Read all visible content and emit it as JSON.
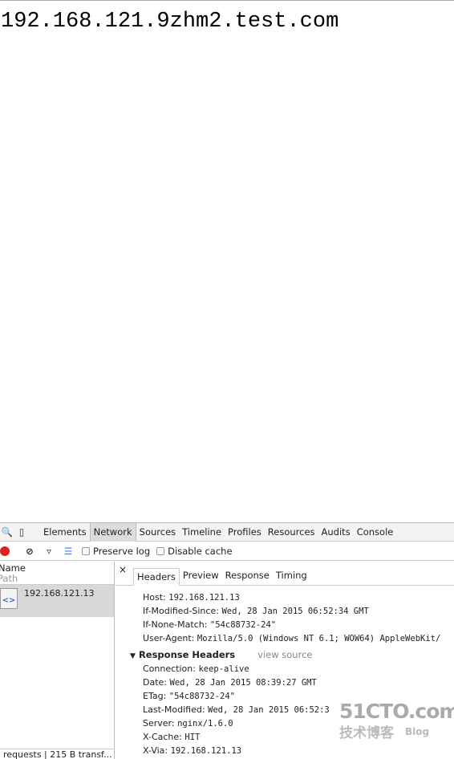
{
  "page": {
    "text": "192.168.121.9zhm2.test.com"
  },
  "devtools": {
    "tabs": [
      "Elements",
      "Network",
      "Sources",
      "Timeline",
      "Profiles",
      "Resources",
      "Audits",
      "Console"
    ],
    "active_tab": "Network",
    "preserve_log": "Preserve log",
    "disable_cache": "Disable cache",
    "record_color": "#e0201f",
    "col_name": "Name",
    "col_path": "Path",
    "request": {
      "name": "192.168.121.13"
    },
    "status": "requests  |  215 B transf...",
    "detail_tabs": [
      "Headers",
      "Preview",
      "Response",
      "Timing"
    ],
    "request_headers": [
      {
        "k": "Host:",
        "v": "192.168.121.13"
      },
      {
        "k": "If-Modified-Since:",
        "v": "Wed, 28 Jan 2015 06:52:34 GMT"
      },
      {
        "k": "If-None-Match:",
        "v": "\"54c88732-24\""
      },
      {
        "k": "User-Agent:",
        "v": "Mozilla/5.0 (Windows NT 6.1; WOW64) AppleWebKit/"
      }
    ],
    "response_title": "Response Headers",
    "view_source": "view source",
    "response_headers": [
      {
        "k": "Connection:",
        "v": "keep-alive"
      },
      {
        "k": "Date:",
        "v": "Wed, 28 Jan 2015 08:39:27 GMT"
      },
      {
        "k": "ETag:",
        "v": "\"54c88732-24\""
      },
      {
        "k": "Last-Modified:",
        "v": "Wed, 28 Jan 2015 06:52:3"
      },
      {
        "k": "Server:",
        "v": "nginx/1.6.0"
      },
      {
        "k": "X-Cache:",
        "v": "HIT"
      },
      {
        "k": "X-Via:",
        "v": "192.168.121.13"
      }
    ]
  },
  "watermark": {
    "line1": "51CTO.com",
    "line2": "技术博客",
    "blog": "Blog"
  }
}
